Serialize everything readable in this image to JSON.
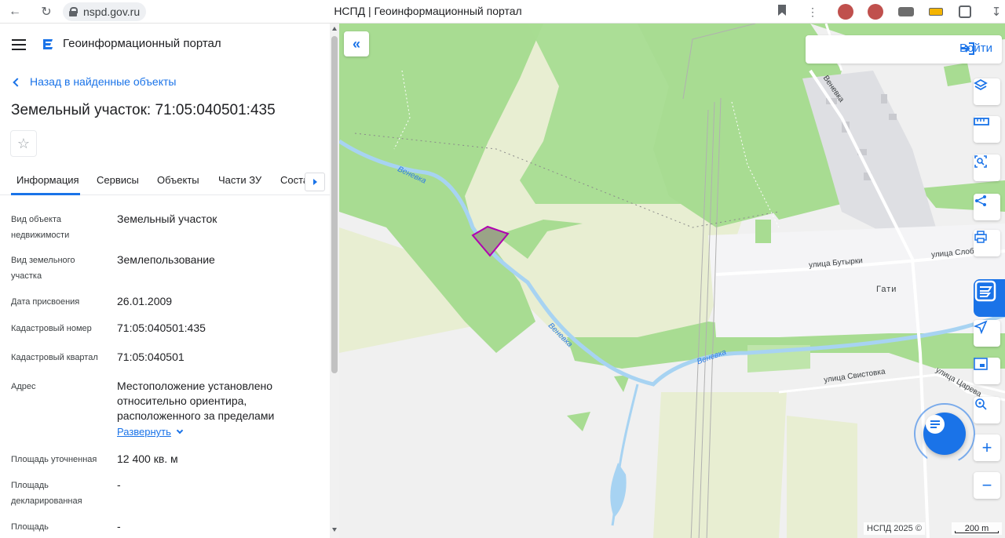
{
  "browser": {
    "url": "nspd.gov.ru",
    "tab_title": "НСПД | Геоинформационный портал"
  },
  "header": {
    "portal_title": "Геоинформационный портал"
  },
  "back_link": "Назад в найденные объекты",
  "object_title": "Земельный участок: 71:05:040501:435",
  "tabs": [
    {
      "label": "Информация"
    },
    {
      "label": "Сервисы"
    },
    {
      "label": "Объекты"
    },
    {
      "label": "Части ЗУ"
    },
    {
      "label": "Соста"
    }
  ],
  "fields": [
    {
      "label": "Вид объекта недвижимости",
      "value": "Земельный участок"
    },
    {
      "label": "Вид земельного участка",
      "value": "Землепользование"
    },
    {
      "label": "Дата присвоения",
      "value": "26.01.2009"
    },
    {
      "label": "Кадастровый номер",
      "value": "71:05:040501:435"
    },
    {
      "label": "Кадастровый квартал",
      "value": "71:05:040501"
    },
    {
      "label": "Адрес",
      "value": "Местоположение установлено относительно ориентира, расположенного за пределами"
    },
    {
      "label": "Площадь уточненная",
      "value": "12 400 кв. м"
    },
    {
      "label": "Площадь декларированная",
      "value": "-"
    },
    {
      "label": "Площадь",
      "value": "-"
    }
  ],
  "expand_label": "Развернуть",
  "map": {
    "login_label": "Войти",
    "copyright": "НСПД 2025 ©",
    "scale": "200 m",
    "labels": {
      "street_buturki": "улица Бутырки",
      "street_slobod": "улица Слобод",
      "village_gati": "Гати",
      "street_svistovka": "улица Свистовка",
      "street_tsareva": "улица Царева",
      "river_1": "Веневка",
      "river_2": "Веневка",
      "river_3": "Веневка",
      "street_top": "Веневка",
      "village_road": "Гати"
    },
    "colors": {
      "forest": "#a8dc92",
      "field": "#e8eed2",
      "river": "#a7d3f2",
      "accent": "#1a73e8",
      "parcel_border": "#b000b0"
    }
  }
}
